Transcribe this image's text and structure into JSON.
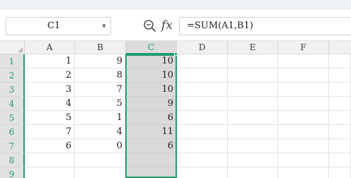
{
  "name_box": {
    "value": "C1",
    "dropdown_icon": "chevron-down-icon"
  },
  "formula_bar": {
    "zoom_icon": "zoom-magnifier-icon",
    "fx_label": "fx",
    "formula": "=SUM(A1,B1)"
  },
  "columns": [
    "A",
    "B",
    "C",
    "D",
    "E",
    "F"
  ],
  "rows": [
    {
      "num": "1",
      "A": "1",
      "B": "9",
      "C": "10"
    },
    {
      "num": "2",
      "A": "2",
      "B": "8",
      "C": "10"
    },
    {
      "num": "3",
      "A": "3",
      "B": "7",
      "C": "10"
    },
    {
      "num": "4",
      "A": "4",
      "B": "5",
      "C": "9"
    },
    {
      "num": "5",
      "A": "5",
      "B": "1",
      "C": "6"
    },
    {
      "num": "6",
      "A": "7",
      "B": "4",
      "C": "11"
    },
    {
      "num": "7",
      "A": "6",
      "B": "0",
      "C": "6"
    },
    {
      "num": "8",
      "A": "",
      "B": "",
      "C": ""
    },
    {
      "num": "9",
      "A": "",
      "B": "",
      "C": ""
    }
  ],
  "selected_column": "C",
  "colors": {
    "accent": "#1f9b6e",
    "selection_fill": "#d9d9d9"
  }
}
